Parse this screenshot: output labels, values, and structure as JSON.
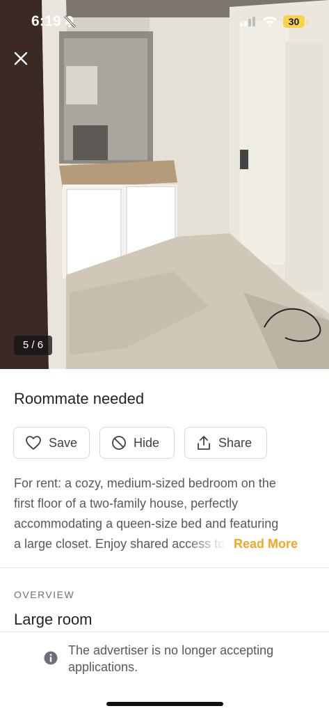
{
  "status_bar": {
    "time": "6:19",
    "battery": "30"
  },
  "gallery": {
    "counter": "5 / 6"
  },
  "listing": {
    "title": "Roommate needed",
    "actions": {
      "save": "Save",
      "hide": "Hide",
      "share": "Share"
    },
    "description": {
      "line1": "For rent: a cozy, medium-sized bedroom on the",
      "line2": "first floor of a two-family house, perfectly",
      "line3": "accommodating a queen-size bed and featuring",
      "line4": "a large closet. Enjoy shared access to",
      "read_more": "Read More"
    },
    "overview": {
      "label": "OVERVIEW",
      "value": "Large room"
    },
    "notice": "The advertiser is no longer accepting applications."
  },
  "colors": {
    "accent": "#f5a623",
    "battery": "#f7d347"
  },
  "icons": [
    "close-icon",
    "bell-slash-icon",
    "signal-icon",
    "wifi-icon",
    "heart-icon",
    "block-icon",
    "share-icon",
    "info-icon"
  ]
}
